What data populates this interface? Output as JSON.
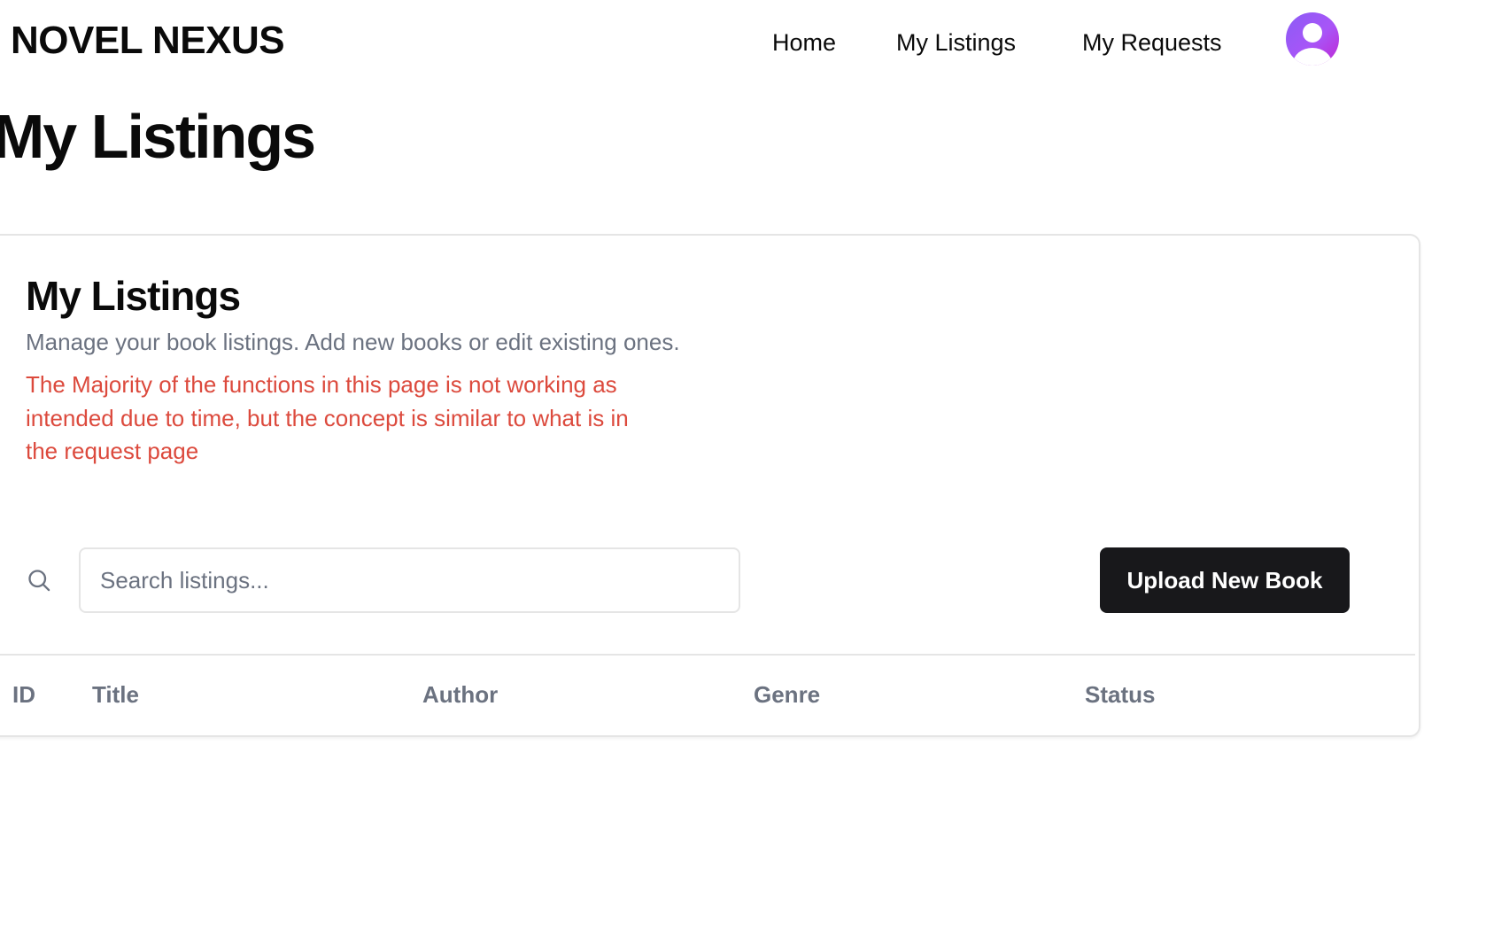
{
  "header": {
    "brand": "NOVEL NEXUS",
    "nav": [
      {
        "label": "Home"
      },
      {
        "label": "My Listings"
      },
      {
        "label": "My Requests"
      }
    ],
    "avatar_icon": "user-icon"
  },
  "page": {
    "title": "My Listings"
  },
  "card": {
    "title": "My Listings",
    "description": "Manage your book listings. Add new books or edit existing ones.",
    "warning": "The Majority of the functions in this page is not working as intended due to time, but the concept is similar to what is in the request page"
  },
  "search": {
    "icon": "search-icon",
    "placeholder": "Search listings...",
    "value": ""
  },
  "actions": {
    "upload_label": "Upload New Book"
  },
  "table": {
    "columns": [
      "ID",
      "Title",
      "Author",
      "Genre",
      "Status"
    ],
    "rows": []
  },
  "colors": {
    "text_primary": "#0a0a0a",
    "text_muted": "#6b7280",
    "warning": "#dc4a3d",
    "button_bg": "#18181b",
    "border": "#e5e5e5",
    "avatar_gradient_start": "#8b5cf6",
    "avatar_gradient_end": "#c026d3"
  }
}
